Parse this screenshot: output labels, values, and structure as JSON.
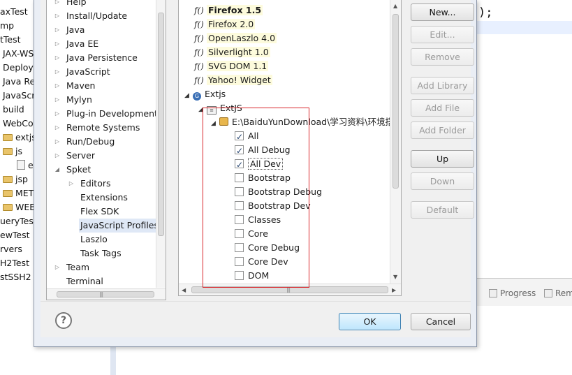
{
  "background": {
    "explorer_items": [
      {
        "label": "axTest",
        "icon": ""
      },
      {
        "label": "mp",
        "icon": ""
      },
      {
        "label": "tTest",
        "icon": ""
      },
      {
        "label": "JAX-WS",
        "icon": ""
      },
      {
        "label": "Deploy",
        "icon": ""
      },
      {
        "label": "Java Re",
        "icon": ""
      },
      {
        "label": "JavaScri",
        "icon": ""
      },
      {
        "label": "build",
        "icon": ""
      },
      {
        "label": "WebCo",
        "icon": ""
      },
      {
        "label": "extjs",
        "icon": "folder-icon"
      },
      {
        "label": "js",
        "icon": "folder-icon"
      },
      {
        "label": "e",
        "icon": "file-icon"
      },
      {
        "label": "jsp",
        "icon": "folder-icon"
      },
      {
        "label": "MET",
        "icon": "folder-icon"
      },
      {
        "label": "WEB",
        "icon": "folder-icon"
      },
      {
        "label": "ueryTest",
        "icon": ""
      },
      {
        "label": "ewTest",
        "icon": ""
      },
      {
        "label": "rvers",
        "icon": ""
      },
      {
        "label": "H2Test",
        "icon": ""
      },
      {
        "label": "stSSH2",
        "icon": ""
      }
    ],
    "code_text": ");",
    "tabs": [
      {
        "label": "Progress",
        "icon": "progress-icon"
      },
      {
        "label": "Rem",
        "icon": "remote-icon"
      }
    ]
  },
  "categories": [
    {
      "label": "Help",
      "arrow": "collapsed"
    },
    {
      "label": "Install/Update",
      "arrow": "collapsed"
    },
    {
      "label": "Java",
      "arrow": "collapsed"
    },
    {
      "label": "Java EE",
      "arrow": "collapsed"
    },
    {
      "label": "Java Persistence",
      "arrow": "collapsed"
    },
    {
      "label": "JavaScript",
      "arrow": "collapsed"
    },
    {
      "label": "Maven",
      "arrow": "collapsed"
    },
    {
      "label": "Mylyn",
      "arrow": "collapsed"
    },
    {
      "label": "Plug-in Development",
      "arrow": "collapsed"
    },
    {
      "label": "Remote Systems",
      "arrow": "collapsed"
    },
    {
      "label": "Run/Debug",
      "arrow": "collapsed"
    },
    {
      "label": "Server",
      "arrow": "collapsed"
    },
    {
      "label": "Spket",
      "arrow": "expanded"
    },
    {
      "label": "Editors",
      "arrow": "collapsed"
    },
    {
      "label": "Extensions",
      "arrow": "none"
    },
    {
      "label": "Flex SDK",
      "arrow": "none"
    },
    {
      "label": "JavaScript Profiles",
      "arrow": "none",
      "selected": true
    },
    {
      "label": "Laszlo",
      "arrow": "none"
    },
    {
      "label": "Task Tags",
      "arrow": "none"
    },
    {
      "label": "Team",
      "arrow": "collapsed"
    },
    {
      "label": "Terminal",
      "arrow": "none"
    }
  ],
  "libraries": {
    "profiles": [
      {
        "label": "Firefox 1.5",
        "bold": true
      },
      {
        "label": "Firefox 2.0",
        "bold": false
      },
      {
        "label": "OpenLaszlo 4.0",
        "bold": false
      },
      {
        "label": "Silverlight 1.0",
        "bold": false
      },
      {
        "label": "SVG DOM 1.1",
        "bold": false
      },
      {
        "label": "Yahoo! Widget",
        "bold": false
      }
    ],
    "extjs": {
      "label": "Extjs",
      "icon": "g",
      "child": {
        "label": "ExtJS",
        "path": "E:\\BaiduYunDownload\\学习资料\\环境搭",
        "modules": [
          {
            "label": "All",
            "checked": true
          },
          {
            "label": "All Debug",
            "checked": true
          },
          {
            "label": "All Dev",
            "checked": true,
            "focused": true
          },
          {
            "label": "Bootstrap",
            "checked": false
          },
          {
            "label": "Bootstrap Debug",
            "checked": false
          },
          {
            "label": "Bootstrap Dev",
            "checked": false
          },
          {
            "label": "Classes",
            "checked": false
          },
          {
            "label": "Core",
            "checked": false
          },
          {
            "label": "Core Debug",
            "checked": false
          },
          {
            "label": "Core Dev",
            "checked": false
          },
          {
            "label": "DOM",
            "checked": false
          }
        ]
      }
    }
  },
  "buttons": {
    "new": "New...",
    "edit": "Edit...",
    "remove": "Remove",
    "add_library": "Add Library",
    "add_file": "Add File",
    "add_folder": "Add Folder",
    "up": "Up",
    "down": "Down",
    "default": "Default"
  },
  "footer": {
    "help": "?",
    "ok": "OK",
    "cancel": "Cancel"
  },
  "colors": {
    "annotation": "#d9262b",
    "ok_accent": "#3c7fb1"
  }
}
